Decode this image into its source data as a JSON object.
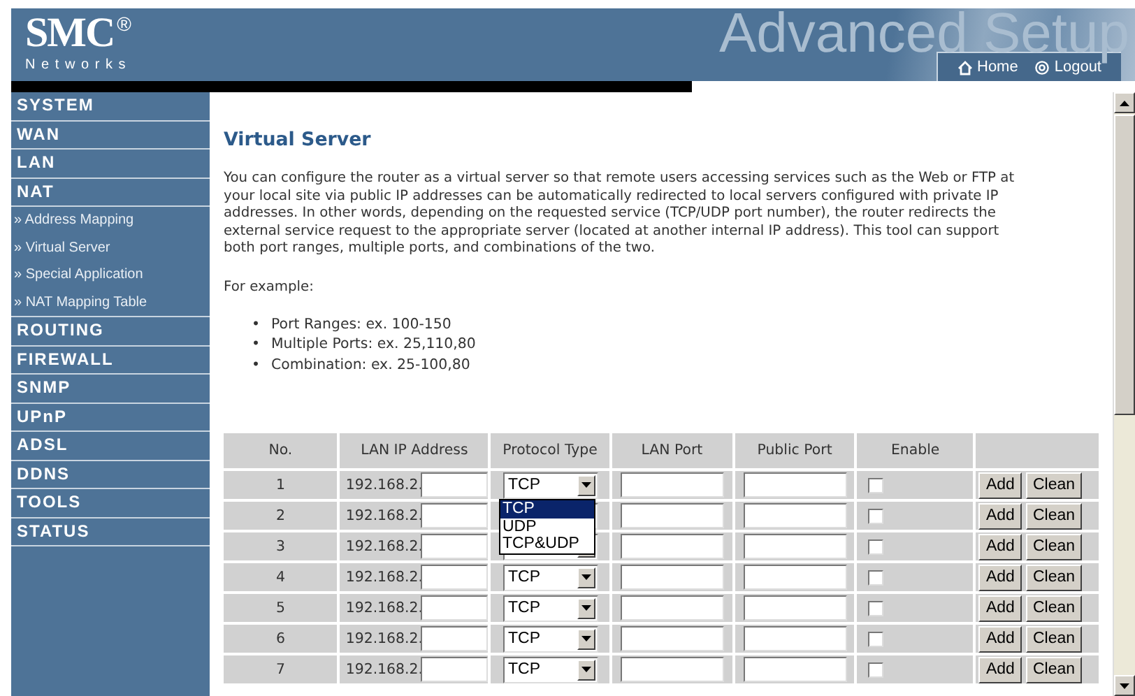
{
  "header": {
    "logo": "SMC",
    "logo_mark": "®",
    "logo_sub": "Networks",
    "banner_title": "Advanced Setup",
    "links": [
      {
        "label": "Home"
      },
      {
        "label": "Logout"
      }
    ]
  },
  "sidebar": {
    "items": [
      {
        "kind": "section",
        "label": "SYSTEM"
      },
      {
        "kind": "section",
        "label": "WAN"
      },
      {
        "kind": "section",
        "label": "LAN"
      },
      {
        "kind": "section",
        "label": "NAT"
      },
      {
        "kind": "sub",
        "label": "» Address Mapping"
      },
      {
        "kind": "sub",
        "label": "» Virtual Server"
      },
      {
        "kind": "sub",
        "label": "» Special Application"
      },
      {
        "kind": "sub",
        "label": "» NAT Mapping Table"
      },
      {
        "kind": "section",
        "label": "ROUTING"
      },
      {
        "kind": "section",
        "label": "FIREWALL"
      },
      {
        "kind": "section",
        "label": "SNMP"
      },
      {
        "kind": "section",
        "label": "UPnP"
      },
      {
        "kind": "section",
        "label": "ADSL"
      },
      {
        "kind": "section",
        "label": "DDNS"
      },
      {
        "kind": "section",
        "label": "TOOLS"
      },
      {
        "kind": "section",
        "label": "STATUS"
      }
    ]
  },
  "content": {
    "title": "Virtual Server",
    "description": "You can configure the router as a virtual server so that remote users accessing services such as the Web or FTP at your local site via public IP addresses can be automatically redirected to local servers configured with private IP addresses. In other words, depending on the requested service (TCP/UDP port number), the router redirects the external service request to the appropriate server (located at another internal IP address). This tool can support both port ranges, multiple ports, and combinations of the two.",
    "example_label": "For example:",
    "examples": [
      {
        "marker": "•",
        "text": "Port Ranges: ex. 100-150"
      },
      {
        "marker": "•",
        "text": "Multiple Ports: ex. 25,110,80"
      },
      {
        "marker": "•",
        "text": "Combination: ex. 25-100,80"
      }
    ]
  },
  "table": {
    "columns": [
      "No.",
      "LAN IP Address",
      "Protocol Type",
      "LAN Port",
      "Public Port",
      "Enable"
    ],
    "rows": [
      {
        "no": "1",
        "ip_prefix": "192.168.2.",
        "protocol": "TCP",
        "enabled": false,
        "add": "Add",
        "clean": "Clean",
        "dropdown_options": [
          {
            "label": "TCP",
            "selected": true
          },
          {
            "label": "UDP",
            "selected": false
          },
          {
            "label": "TCP&UDP",
            "selected": false
          }
        ]
      },
      {
        "no": "2",
        "ip_prefix": "192.168.2.",
        "enabled": false,
        "add": "Add",
        "clean": "Clean"
      },
      {
        "no": "3",
        "ip_prefix": "192.168.2.",
        "enabled": false,
        "add": "Add",
        "clean": "Clean"
      },
      {
        "no": "4",
        "ip_prefix": "192.168.2.",
        "protocol": "TCP",
        "enabled": false,
        "add": "Add",
        "clean": "Clean"
      },
      {
        "no": "5",
        "ip_prefix": "192.168.2.",
        "protocol": "TCP",
        "enabled": false,
        "add": "Add",
        "clean": "Clean"
      },
      {
        "no": "6",
        "ip_prefix": "192.168.2.",
        "protocol": "TCP",
        "enabled": false,
        "add": "Add",
        "clean": "Clean"
      },
      {
        "no": "7",
        "ip_prefix": "192.168.2.",
        "protocol": "TCP",
        "enabled": false,
        "add": "Add",
        "clean": "Clean"
      }
    ]
  }
}
